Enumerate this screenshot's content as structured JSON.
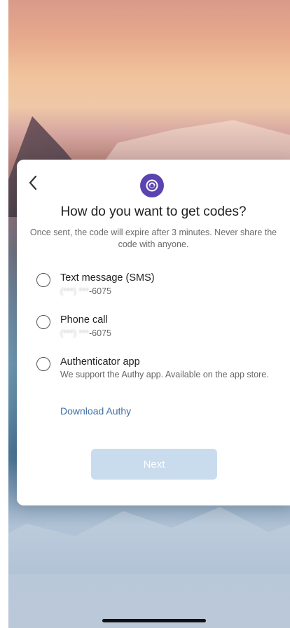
{
  "header": {
    "title": "How do you want to get codes?",
    "subtitle": "Once sent, the code will expire after 3 minutes. Never share the code with anyone."
  },
  "options": [
    {
      "label": "Text message (SMS)",
      "number_masked": "(***) ***",
      "number_suffix": "-6075"
    },
    {
      "label": "Phone call",
      "number_masked": "(***) ***",
      "number_suffix": "-6075"
    },
    {
      "label": "Authenticator app",
      "description": "We support the Authy app. Available on the app store."
    }
  ],
  "download_link": "Download Authy",
  "next_button": "Next",
  "colors": {
    "accent": "#5b43b0",
    "link": "#3e6fa3",
    "button_disabled": "#c8dcee"
  },
  "icons": {
    "back": "chevron-left-icon",
    "logo": "authy-logo-icon",
    "radio": "radio-unselected-icon"
  }
}
